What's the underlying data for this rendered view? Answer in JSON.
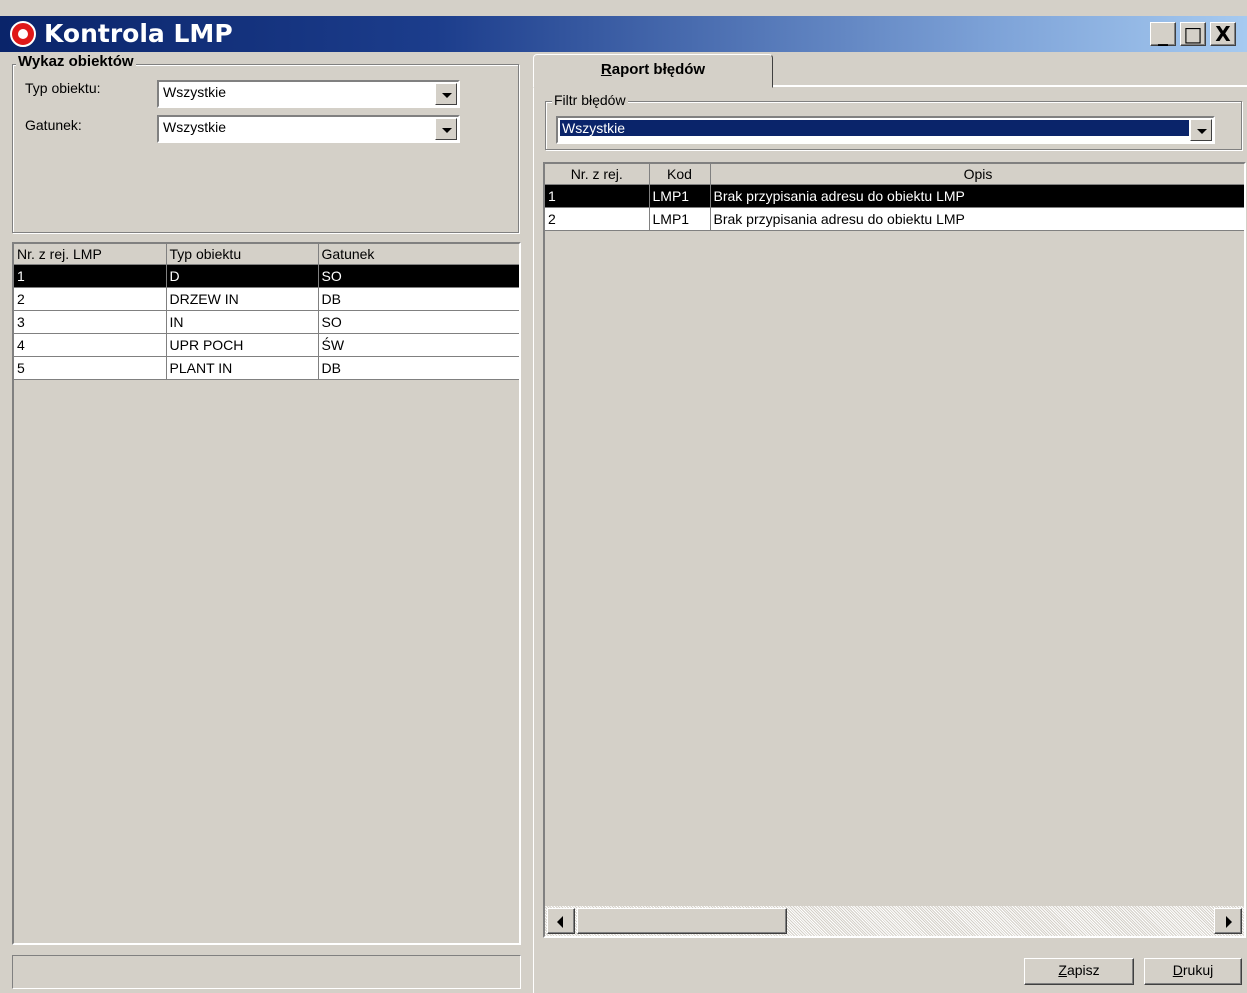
{
  "window": {
    "title": "Kontrola LMP"
  },
  "object_list": {
    "group_title": "Wykaz obiektów",
    "type_label": "Typ obiektu:",
    "type_value": "Wszystkie",
    "species_label": "Gatunek:",
    "species_value": "Wszystkie",
    "columns": [
      "Nr. z rej. LMP",
      "Typ obiektu",
      "Gatunek"
    ],
    "rows": [
      [
        "1",
        "D",
        "SO"
      ],
      [
        "2",
        "DRZEW IN",
        "DB"
      ],
      [
        "3",
        "IN",
        "SO"
      ],
      [
        "4",
        "UPR POCH",
        "ŚW"
      ],
      [
        "5",
        "PLANT IN",
        "DB"
      ]
    ],
    "selected_row": 0
  },
  "report": {
    "tab_label_first": "R",
    "tab_label_rest": "aport błędów",
    "filter_title": "Filtr błędów",
    "filter_value": "Wszystkie",
    "columns": [
      "Nr. z rej.",
      "Kod",
      "Opis"
    ],
    "rows": [
      [
        "1",
        "LMP1",
        "Brak przypisania adresu do obiektu LMP"
      ],
      [
        "2",
        "LMP1",
        "Brak przypisania adresu do obiektu LMP"
      ]
    ],
    "selected_row": 0
  },
  "buttons": {
    "save_first": "Z",
    "save_rest": "apisz",
    "print_first": "D",
    "print_rest": "rukuj"
  },
  "caption_buttons": {
    "minimize": "_",
    "maximize": "□",
    "close": "X"
  }
}
